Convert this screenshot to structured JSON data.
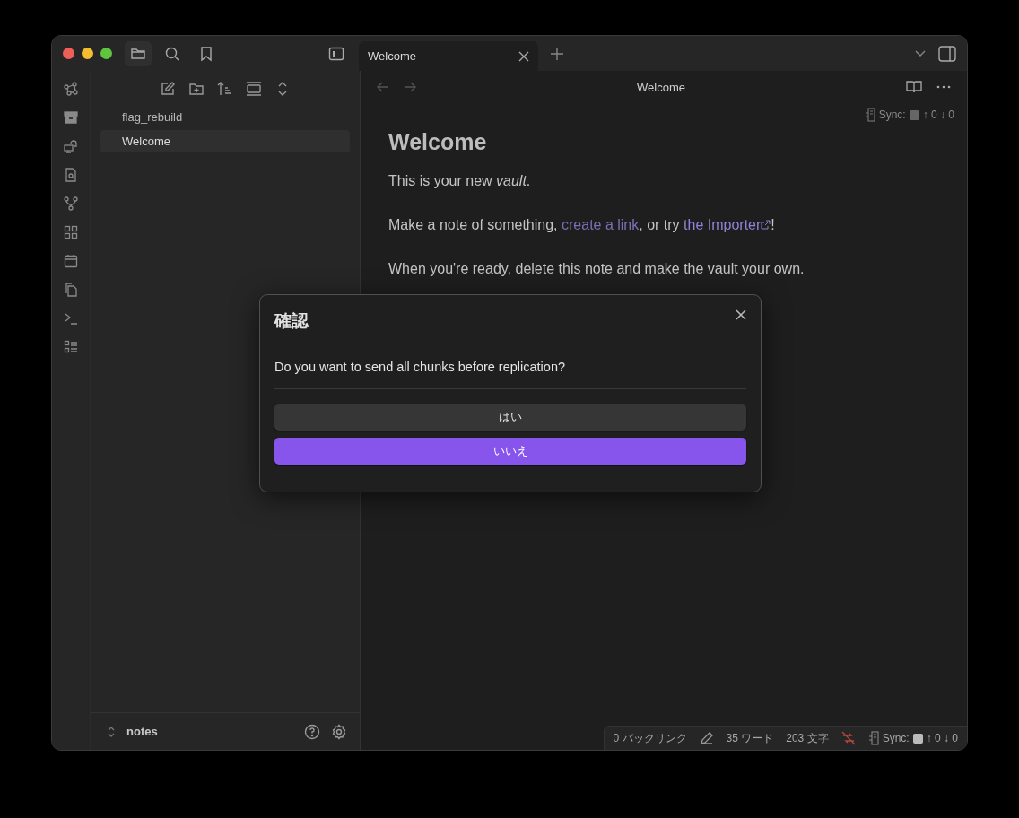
{
  "tabs": [
    {
      "label": "Welcome",
      "selected": true
    }
  ],
  "sidebar": {
    "files": [
      {
        "name": "flag_rebuild",
        "selected": false
      },
      {
        "name": "Welcome",
        "selected": true
      }
    ],
    "vault_name": "notes"
  },
  "view_header": {
    "title": "Welcome"
  },
  "sync_status_top": {
    "label": "Sync:",
    "counts": "↑ 0 ↓ 0"
  },
  "note": {
    "heading": "Welcome",
    "paragraphs": [
      [
        {
          "kind": "text",
          "text": "This is your new *vault*."
        }
      ],
      [
        {
          "kind": "text",
          "text": "Make a note of something, "
        },
        {
          "kind": "internal_link",
          "text": "create a link"
        },
        {
          "kind": "text",
          "text": ", or try "
        },
        {
          "kind": "external_link",
          "text": "the Importer"
        },
        {
          "kind": "text",
          "text": "!"
        }
      ],
      [
        {
          "kind": "text",
          "text": "When you're ready, delete this note and make the vault your own."
        }
      ]
    ]
  },
  "status_bar": {
    "backlinks": "0 バックリンク",
    "words": "35 ワード",
    "characters": "203 文字",
    "sync_label": "Sync:",
    "sync_counts": "↑ 0 ↓ 0"
  },
  "dialog": {
    "title": "確認",
    "message": "Do you want to send all chunks before replication?",
    "buttons": [
      {
        "label": "はい",
        "kind": "default"
      },
      {
        "label": "いいえ",
        "kind": "primary"
      }
    ]
  }
}
